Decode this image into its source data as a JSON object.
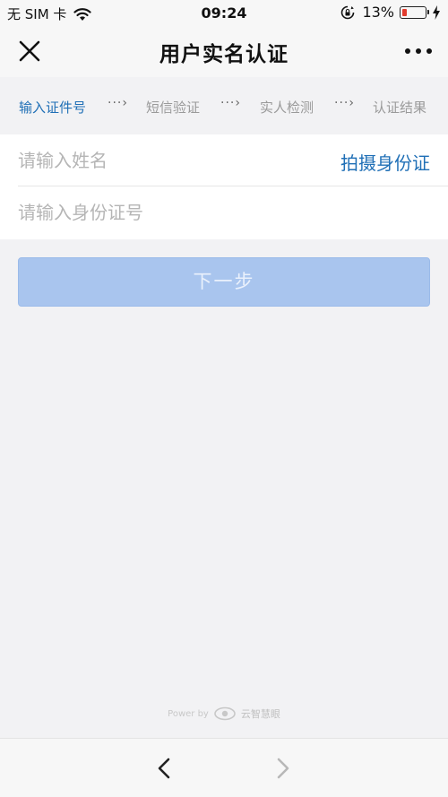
{
  "status_bar": {
    "carrier": "无 SIM 卡",
    "time": "09:24",
    "battery_percent": "13%",
    "battery_level": 0.13,
    "battery_color": "#e23b2e"
  },
  "nav": {
    "title": "用户实名认证",
    "close_icon": "close-icon",
    "more_icon": "more-dots-icon"
  },
  "steps": [
    {
      "label": "输入证件号",
      "active": true
    },
    {
      "label": "短信验证",
      "active": false
    },
    {
      "label": "实人检测",
      "active": false
    },
    {
      "label": "认证结果",
      "active": false
    }
  ],
  "step_separator": "···›",
  "form": {
    "name_placeholder": "请输入姓名",
    "id_placeholder": "请输入身份证号",
    "scan_id_label": "拍摄身份证"
  },
  "next_button": {
    "label": "下一步",
    "enabled": false
  },
  "footer": {
    "powered_by": "Power by",
    "brand": "云智慧眼"
  },
  "colors": {
    "accent": "#1f6fb6",
    "button_disabled": "#a9c5ee",
    "background": "#f2f2f4"
  }
}
